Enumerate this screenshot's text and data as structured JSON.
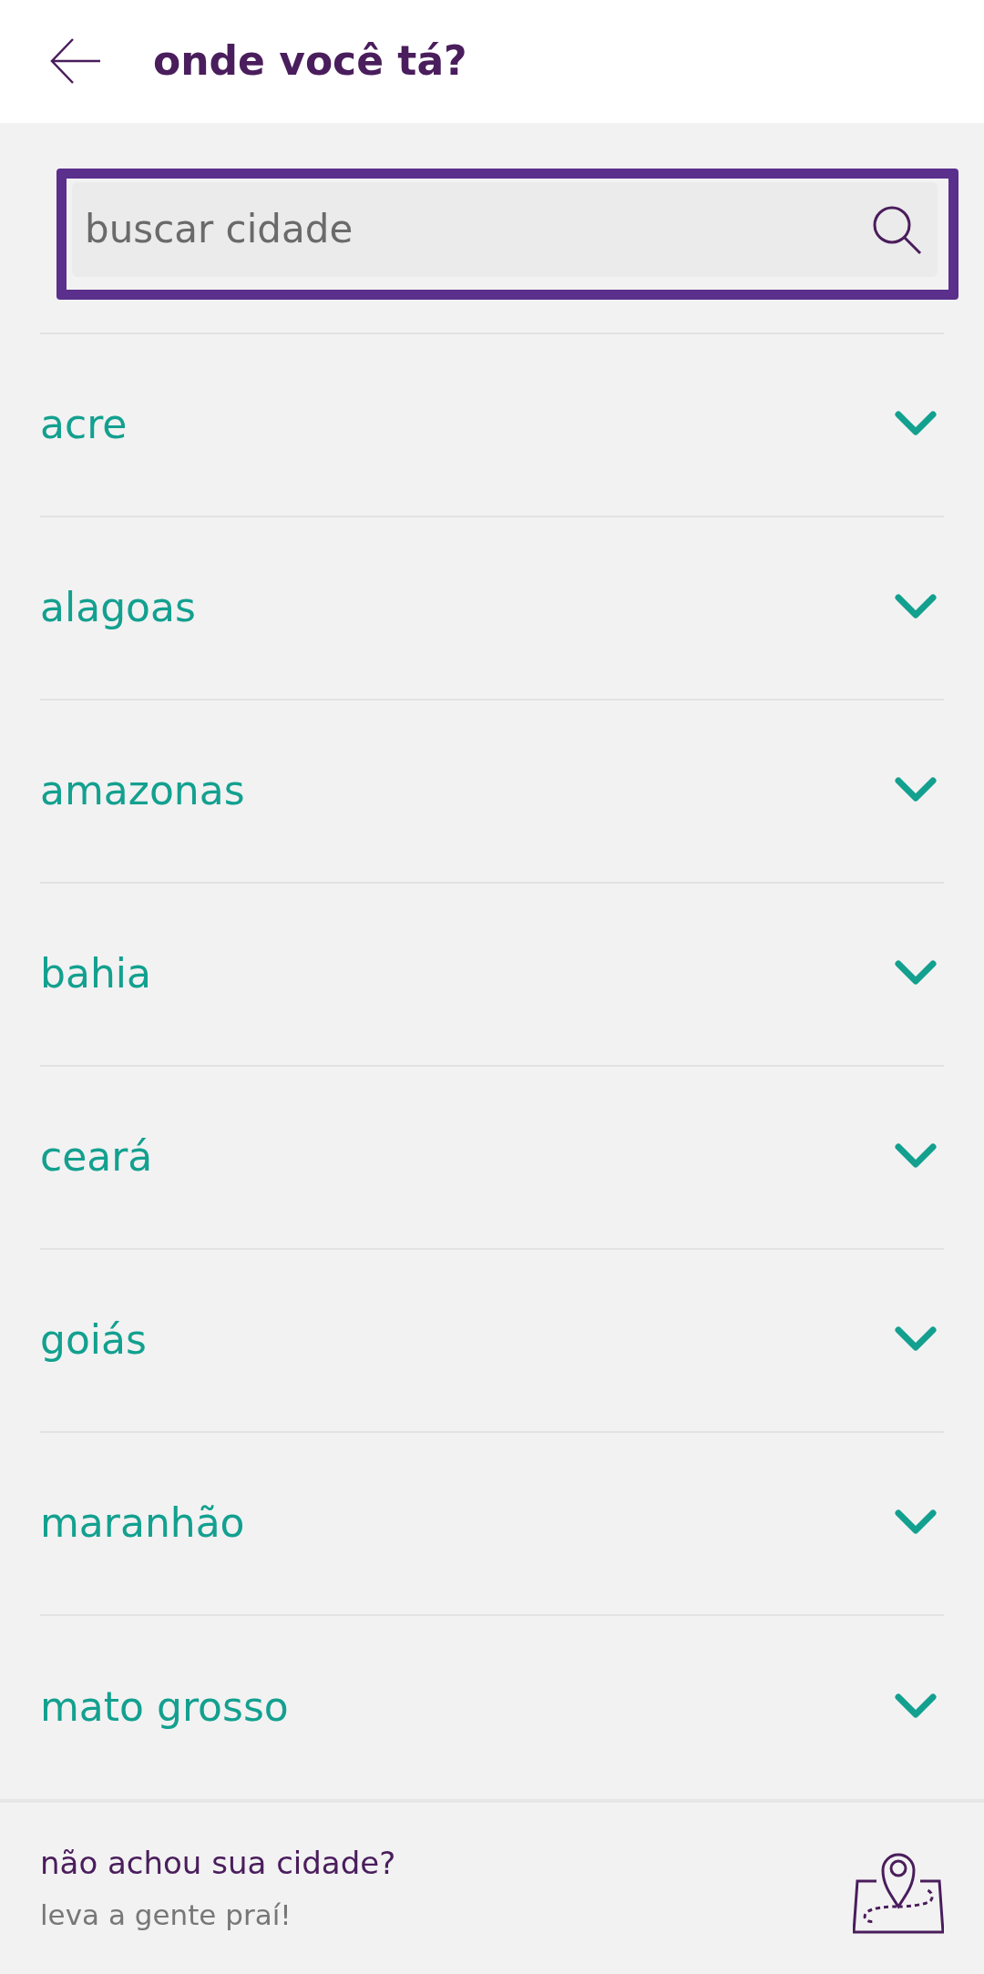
{
  "header": {
    "title": "onde você tá?"
  },
  "search": {
    "placeholder": "buscar cidade"
  },
  "states": [
    {
      "name": "acre",
      "expanded": false
    },
    {
      "name": "alagoas",
      "expanded": false
    },
    {
      "name": "amazonas",
      "expanded": false
    },
    {
      "name": "bahia",
      "expanded": false
    },
    {
      "name": "ceará",
      "expanded": false
    },
    {
      "name": "goiás",
      "expanded": false
    },
    {
      "name": "maranhão",
      "expanded": false
    },
    {
      "name": "mato grosso",
      "expanded": false
    }
  ],
  "footer": {
    "title": "não achou sua cidade?",
    "subtitle": "leva a gente praí!"
  }
}
